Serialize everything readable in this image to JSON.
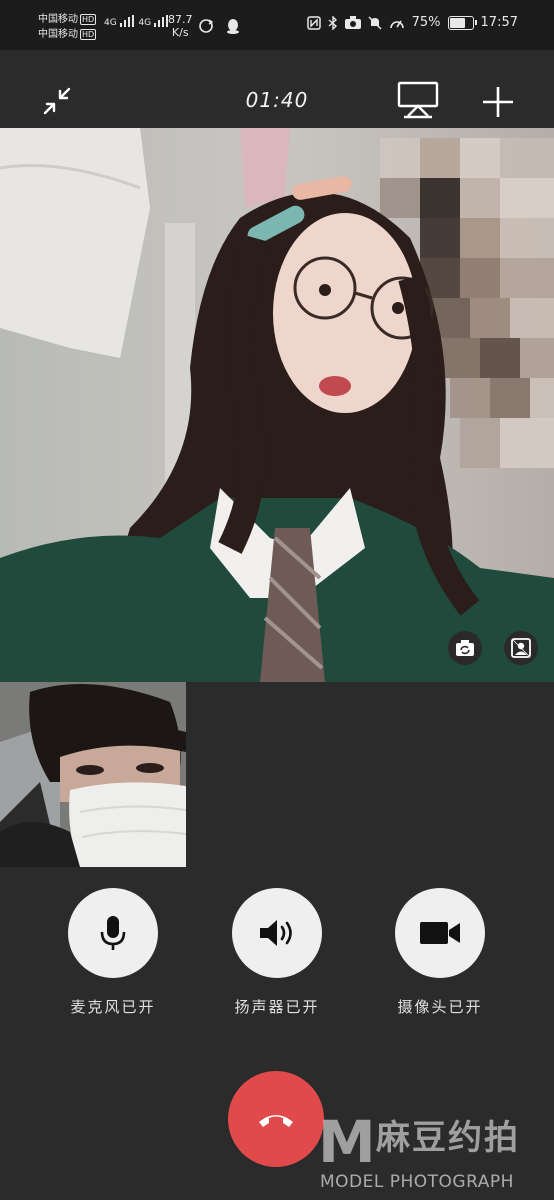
{
  "status_bar": {
    "carrier_1": "中国移动",
    "carrier_2": "中国移动",
    "hd_badge": "HD",
    "network": "4G",
    "speed_value": "87.7",
    "speed_unit": "K/s",
    "battery_text": "75%",
    "battery_level": 0.75,
    "time": "17:57"
  },
  "call": {
    "timer": "01:40"
  },
  "controls": [
    {
      "label": "麦克风已开",
      "icon": "microphone-icon"
    },
    {
      "label": "扬声器已开",
      "icon": "speaker-icon"
    },
    {
      "label": "摄像头已开",
      "icon": "camera-icon"
    }
  ],
  "hangup": {
    "icon": "hangup-icon"
  },
  "watermark": {
    "logo_letter": "M",
    "brand_cn": "麻豆约拍",
    "brand_en": "MODEL PHOTOGRAPH"
  },
  "colors": {
    "background": "#2b2b2b",
    "hangup": "#e04a4a",
    "control_button": "#efefef"
  }
}
